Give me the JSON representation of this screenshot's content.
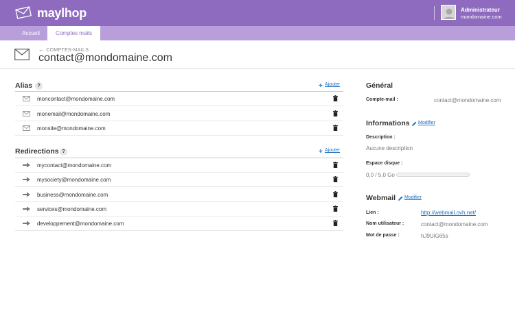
{
  "app": {
    "name": "maylhop",
    "brand_color": "#8e6bbf",
    "nav_color": "#b89fdc",
    "link_color": "#1a6ec0"
  },
  "user": {
    "name": "Administrateur",
    "domain": "mondomaine.com"
  },
  "nav": {
    "tabs": [
      {
        "label": "Accueil",
        "active": false
      },
      {
        "label": "Comptes mails",
        "active": true
      }
    ]
  },
  "page": {
    "breadcrumb": "COMPTES-MAILS",
    "title": "contact@mondomaine.com"
  },
  "alias": {
    "title": "Alias",
    "help": "?",
    "add_label": "Ajouter",
    "items": [
      {
        "address": "moncontact@mondomaine.com"
      },
      {
        "address": "monemail@mondomaine.com"
      },
      {
        "address": "monsite@mondomaine.com"
      }
    ]
  },
  "redirections": {
    "title": "Redirections",
    "help": "?",
    "add_label": "Ajouter",
    "items": [
      {
        "address": "mycontact@mondomaine.com"
      },
      {
        "address": "mysociety@mondomaine.com"
      },
      {
        "address": "business@mondomaine.com"
      },
      {
        "address": "services@mondomaine.com"
      },
      {
        "address": "developpement@mondomaine.com"
      }
    ]
  },
  "general": {
    "title": "Général",
    "account_label": "Compte-mail :",
    "account_value": "contact@mondomaine.com"
  },
  "informations": {
    "title": "Informations",
    "edit_label": "Modifier",
    "description_label": "Description :",
    "description_value": "Aucune description",
    "disk_label": "Espace disque :",
    "disk_value": "0,0 / 5,0 Go",
    "disk_used_fraction": 0
  },
  "webmail": {
    "title": "Webmail",
    "edit_label": "Modifier",
    "link_label": "Lien :",
    "link_value": "http://webmail.ovh.net/",
    "username_label": "Nom utilisateur :",
    "username_value": "contact@mondomaine.com",
    "password_label": "Mot de passe :",
    "password_value": "hJ9UiG65s"
  }
}
